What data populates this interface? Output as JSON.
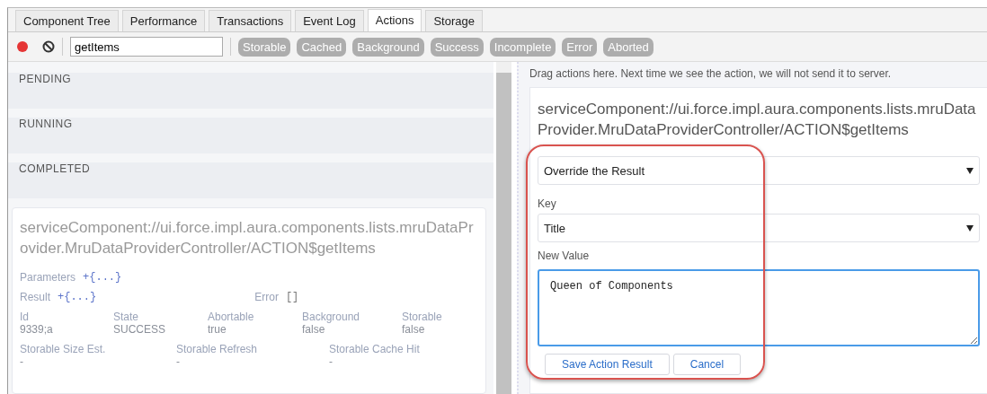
{
  "tabs": [
    {
      "label": "Component Tree",
      "selected": false
    },
    {
      "label": "Performance",
      "selected": false
    },
    {
      "label": "Transactions",
      "selected": false
    },
    {
      "label": "Event Log",
      "selected": false
    },
    {
      "label": "Actions",
      "selected": true
    },
    {
      "label": "Storage",
      "selected": false
    }
  ],
  "toolbar": {
    "recording": true,
    "filter_value": "getItems",
    "filters": [
      "Storable",
      "Cached",
      "Background",
      "Success",
      "Incomplete",
      "Error",
      "Aborted"
    ]
  },
  "sections": [
    "PENDING",
    "RUNNING",
    "COMPLETED"
  ],
  "completed_action": {
    "name": "serviceComponent://ui.force.impl.aura.components.lists.mruDataProvider.MruDataProviderController/ACTION$getItems",
    "parameters_label": "Parameters",
    "parameters_value": "+{...}",
    "result_label": "Result",
    "result_value": "+{...}",
    "error_label": "Error",
    "error_value": "[]",
    "fields": [
      {
        "label": "Id",
        "value": "9339;a"
      },
      {
        "label": "State",
        "value": "SUCCESS"
      },
      {
        "label": "Abortable",
        "value": "true"
      },
      {
        "label": "Background",
        "value": "false"
      },
      {
        "label": "Storable",
        "value": "false"
      }
    ],
    "storage_fields": [
      {
        "label": "Storable Size Est.",
        "value": "-"
      },
      {
        "label": "Storable Refresh",
        "value": "-"
      },
      {
        "label": "Storable Cache Hit",
        "value": "-"
      }
    ]
  },
  "override": {
    "hint": "Drag actions here. Next time we see the action, we will not send it to server.",
    "action_name": "serviceComponent://ui.force.impl.aura.components.lists.mruDataProvider.MruDataProviderController/ACTION$getItems",
    "mode": "Override the Result",
    "key_label": "Key",
    "key": "Title",
    "value_label": "New Value",
    "value": "Queen of Components",
    "buttons": [
      "Save Action Result",
      "Cancel"
    ]
  }
}
